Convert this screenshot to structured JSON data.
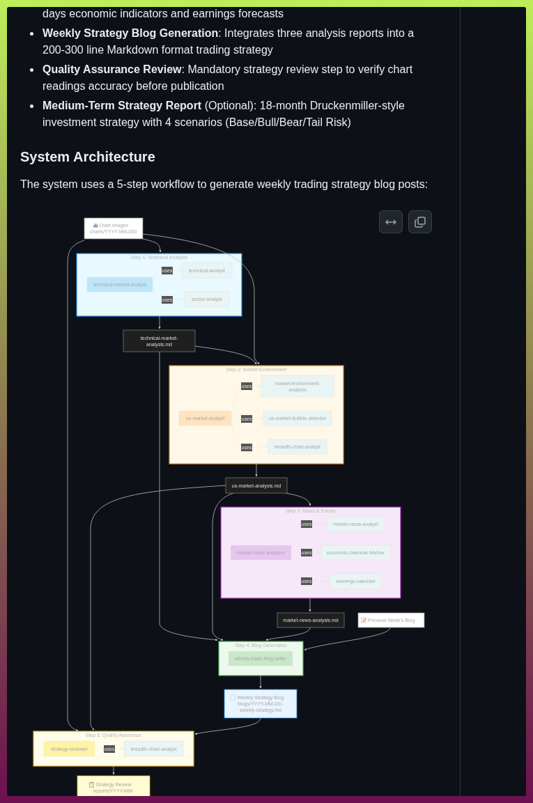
{
  "intro_fragment": "days economic indicators and earnings forecasts",
  "features": [
    "**Weekly Strategy Blog Generation**: Integrates three analysis reports into a 200-300 line Markdown format trading strategy",
    "**Quality Assurance Review**: Mandatory strategy review step to verify chart readings accuracy before publication",
    "**Medium-Term Strategy Report** (Optional): 18-month Druckenmiller-style investment strategy with 4 scenarios (Base/Bull/Bear/Tail Risk)"
  ],
  "section_heading": "System Architecture",
  "section_text": "The system uses a 5-step workflow to generate weekly trading strategy blog posts:",
  "diagram": {
    "chart_images": {
      "lines": [
        "Chart Images",
        "charts/YYYY-MM-DD/"
      ]
    },
    "previous_blog": {
      "lines": [
        "Previous Week's Blog"
      ]
    },
    "steps": [
      {
        "title": "Step 1: Technical Analysis",
        "agent": "technical-market-analyst",
        "tools": [
          {
            "edge_label": "uses",
            "lines": [
              "technical-analyst"
            ]
          },
          {
            "edge_label": "uses",
            "lines": [
              "sector-analyst"
            ]
          }
        ],
        "output": {
          "kind": "markdown",
          "lines": [
            "technical-market-",
            "analysis.md"
          ]
        }
      },
      {
        "title": "Step 2: Market Environment",
        "agent": "us-market-analyst",
        "tools": [
          {
            "edge_label": "uses",
            "lines": [
              "market-environment-",
              "analysis"
            ]
          },
          {
            "edge_label": "uses",
            "lines": [
              "us-market-bubble-detector"
            ]
          },
          {
            "edge_label": "uses",
            "lines": [
              "breadth-chart-analyst"
            ]
          }
        ],
        "output": {
          "kind": "markdown",
          "lines": [
            "us-market-analysis.md"
          ]
        }
      },
      {
        "title": "Step 3: News & Events",
        "agent": "market-news-analyzer",
        "tools": [
          {
            "edge_label": "uses",
            "lines": [
              "market-news-analyst"
            ]
          },
          {
            "edge_label": "uses",
            "lines": [
              "economic-calendar-fetcher"
            ]
          },
          {
            "edge_label": "uses",
            "lines": [
              "earnings-calendar"
            ]
          }
        ],
        "output": {
          "kind": "markdown",
          "lines": [
            "market-news-analysis.md"
          ]
        }
      },
      {
        "title": "Step 4: Blog Generation",
        "agent": "weekly-trade-blog-writer",
        "output": {
          "kind": "document",
          "lines": [
            "Weekly Strategy Blog",
            "blogs/YYYY-MM-DD-",
            "weekly-strategy.md"
          ]
        }
      },
      {
        "title": "Step 5: Quality Assurance",
        "agent": "strategy-reviewer",
        "tools": [
          {
            "edge_label": "uses",
            "lines": [
              "breadth-chart-analyst"
            ]
          }
        ],
        "output": {
          "kind": "report",
          "lines": [
            "Strategy Review",
            "reports/YYYY-MM-"
          ]
        }
      }
    ]
  }
}
